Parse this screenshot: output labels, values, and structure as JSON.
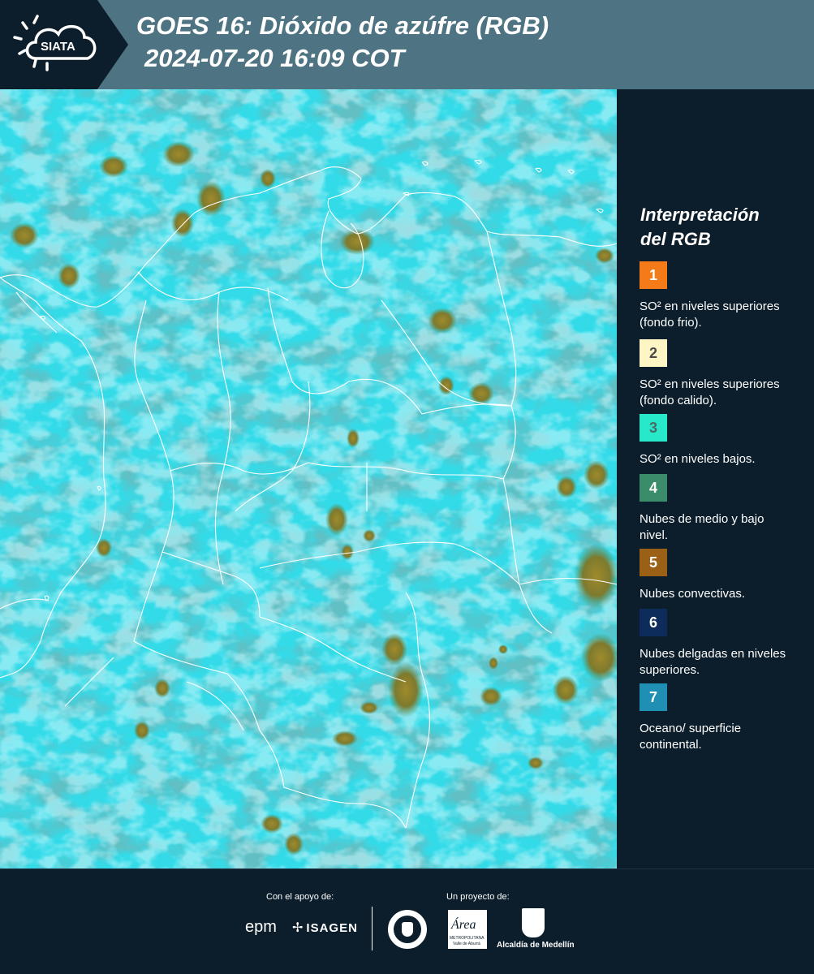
{
  "header": {
    "logo_text": "SIATA",
    "title_line1": "GOES 16: Dióxido de azúfre (RGB)",
    "title_line2": "2024-07-20 16:09 COT"
  },
  "legend": {
    "title_line1": "Interpretación",
    "title_line2": "del RGB",
    "items": [
      {
        "number": "1",
        "color": "#f47b17",
        "text": "SO² en niveles superiores (fondo frio)."
      },
      {
        "number": "2",
        "color": "#fdf5c4",
        "text": "SO² en niveles superiores (fondo calido)."
      },
      {
        "number": "3",
        "color": "#27e8c9",
        "text": "SO² en niveles bajos."
      },
      {
        "number": "4",
        "color": "#3a8c6a",
        "text": "Nubes de medio y bajo nivel."
      },
      {
        "number": "5",
        "color": "#9a6116",
        "text": "Nubes convectivas."
      },
      {
        "number": "6",
        "color": "#0d2c5b",
        "text": "Nubes delgadas en niveles superiores."
      },
      {
        "number": "7",
        "color": "#1f8fb3",
        "text": "Oceano/ superficie continental."
      }
    ]
  },
  "footer": {
    "support_label": "Con el apoyo de:",
    "project_label": "Un proyecto de:",
    "sponsors": [
      "epm",
      "ISAGEN"
    ],
    "partners": [
      "Área Metropolitana Valle de Aburrá",
      "Alcaldía de Medellín"
    ],
    "area_logo_text": "Área",
    "area_logo_subtext": "METROPOLITANA",
    "area_logo_subtext2": "Valle de Aburrá",
    "alcaldia_text": "Alcaldía de Medellín"
  },
  "colors": {
    "header_bg": "#4e7382",
    "panel_bg": "#0c1e2b",
    "map_base": "#32dcea",
    "convective": "#8a7a2a"
  }
}
